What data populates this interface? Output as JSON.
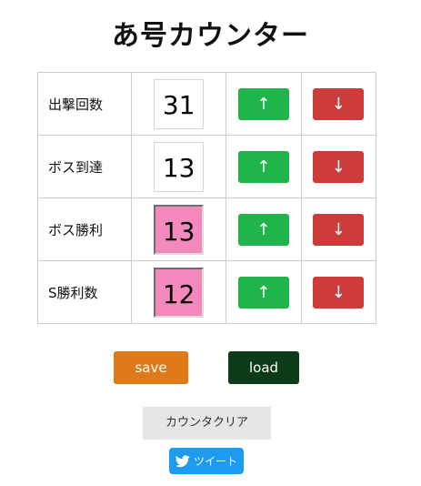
{
  "title": "あ号カウンター",
  "counters": [
    {
      "label": "出撃回数",
      "value": "31",
      "highlight": false
    },
    {
      "label": "ボス到達",
      "value": "13",
      "highlight": false
    },
    {
      "label": "ボス勝利",
      "value": "13",
      "highlight": true
    },
    {
      "label": "S勝利数",
      "value": "12",
      "highlight": true
    }
  ],
  "buttons": {
    "up": "↑",
    "down": "↓",
    "save": "save",
    "load": "load",
    "clear": "カウンタクリア",
    "tweet": "ツイート"
  },
  "icons": {
    "tweet": "twitter-bird-icon"
  },
  "colors": {
    "up": "#1fb54a",
    "down": "#cd3b3b",
    "save": "#e07a18",
    "load": "#0d3a17",
    "highlight": "#f389bd",
    "tweet": "#1d9bf0"
  }
}
